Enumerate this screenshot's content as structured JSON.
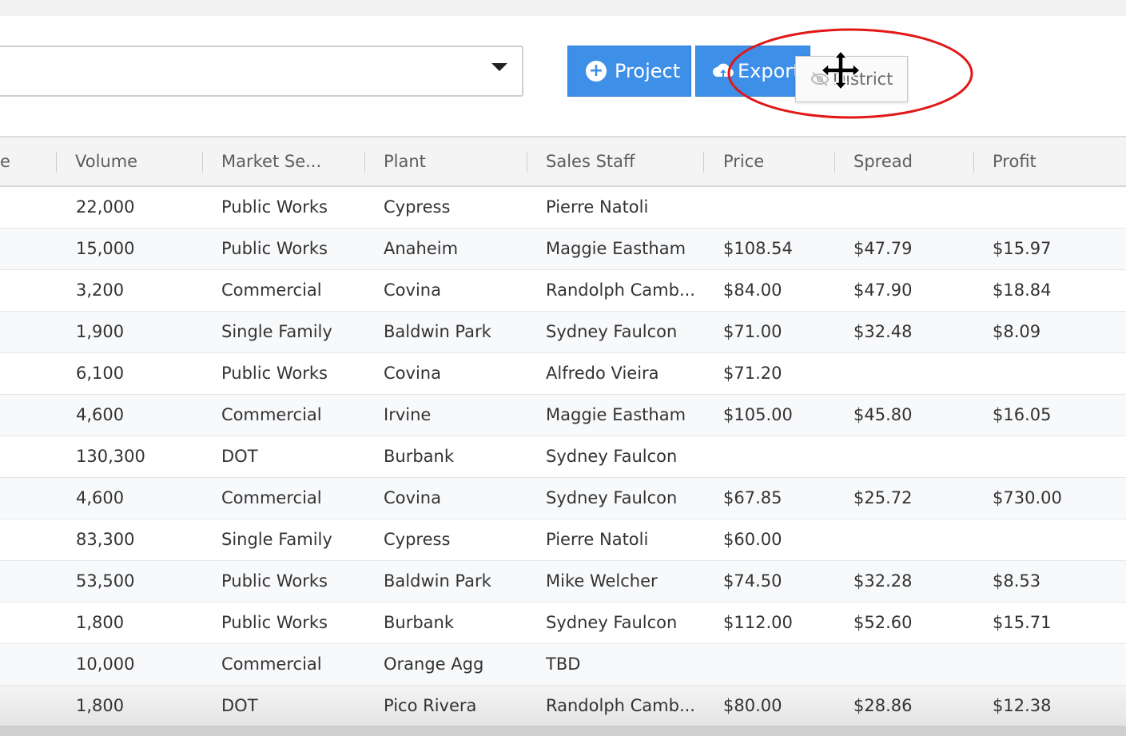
{
  "toolbar": {
    "project_label": "Project",
    "export_label": "Export",
    "dragged_column_label": "District"
  },
  "grid": {
    "columns": [
      "e",
      "Volume",
      "Market Se...",
      "Plant",
      "Sales Staff",
      "Price",
      "Spread",
      "Profit"
    ],
    "rows": [
      [
        "22,000",
        "Public Works",
        "Cypress",
        "Pierre Natoli",
        "",
        "",
        ""
      ],
      [
        "15,000",
        "Public Works",
        "Anaheim",
        "Maggie Eastham",
        "$108.54",
        "$47.79",
        "$15.97"
      ],
      [
        "3,200",
        "Commercial",
        "Covina",
        "Randolph Camb...",
        "$84.00",
        "$47.90",
        "$18.84"
      ],
      [
        "1,900",
        "Single Family",
        "Baldwin Park",
        "Sydney Faulcon",
        "$71.00",
        "$32.48",
        "$8.09"
      ],
      [
        "6,100",
        "Public Works",
        "Covina",
        "Alfredo Vieira",
        "$71.20",
        "",
        ""
      ],
      [
        "4,600",
        "Commercial",
        "Irvine",
        "Maggie Eastham",
        "$105.00",
        "$45.80",
        "$16.05"
      ],
      [
        "130,300",
        "DOT",
        "Burbank",
        "Sydney Faulcon",
        "",
        "",
        ""
      ],
      [
        "4,600",
        "Commercial",
        "Covina",
        "Sydney Faulcon",
        "$67.85",
        "$25.72",
        "$730.00"
      ],
      [
        "83,300",
        "Single Family",
        "Cypress",
        "Pierre Natoli",
        "$60.00",
        "",
        ""
      ],
      [
        "53,500",
        "Public Works",
        "Baldwin Park",
        "Mike Welcher",
        "$74.50",
        "$32.28",
        "$8.53"
      ],
      [
        "1,800",
        "Public Works",
        "Burbank",
        "Sydney Faulcon",
        "$112.00",
        "$52.60",
        "$15.71"
      ],
      [
        "10,000",
        "Commercial",
        "Orange Agg",
        "TBD",
        "",
        "",
        ""
      ],
      [
        "1,800",
        "DOT",
        "Pico Rivera",
        "Randolph Camb...",
        "$80.00",
        "$28.86",
        "$12.38"
      ]
    ]
  },
  "colors": {
    "button_blue": "#3d8fe8",
    "annotation_red": "#e01818"
  },
  "icons": {
    "project": "plus-circle-icon",
    "export": "cloud-upload-icon",
    "dragged": "eye-slash-icon",
    "cursor": "move-cursor-icon",
    "dropdown": "caret-down-icon"
  }
}
